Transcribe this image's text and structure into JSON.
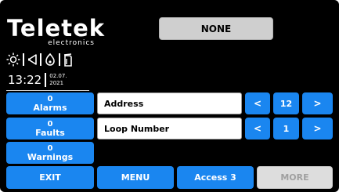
{
  "brand": {
    "name": "Teletek",
    "subtitle": "electronics"
  },
  "status_icons": [
    "sun-icon",
    "horn-icon",
    "flame-icon",
    "extinguisher-icon"
  ],
  "clock": {
    "time": "13:22",
    "date_day_month": "02.07.",
    "date_year": "2021"
  },
  "header": {
    "title": "NONE"
  },
  "side_buttons": {
    "alarms_count": "0",
    "alarms_label": "Alarms",
    "faults_count": "0",
    "faults_label": "Faults",
    "warnings_count": "0",
    "warnings_label": "Warnings"
  },
  "form": {
    "address_label": "Address",
    "address_value": "12",
    "loop_label": "Loop Number",
    "loop_value": "1",
    "prev_symbol": "<",
    "next_symbol": ">"
  },
  "bottom_bar": {
    "exit_label": "EXIT",
    "menu_label": "MENU",
    "access_label": "Access 3",
    "more_label": "MORE"
  },
  "colors": {
    "background": "#000000",
    "accent_blue": "#1a86f0",
    "panel_gray": "#cfcfcf",
    "field_white": "#ffffff"
  }
}
